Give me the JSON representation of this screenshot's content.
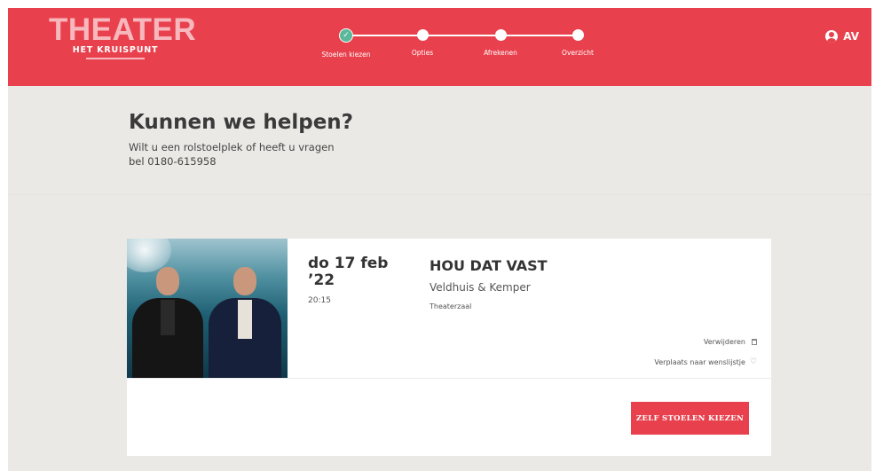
{
  "header": {
    "logo": {
      "main": "THEATER",
      "sub": "HET KRUISPUNT"
    },
    "steps": [
      {
        "label": "Stoelen kiezen",
        "status": "done"
      },
      {
        "label": "Opties",
        "status": "todo"
      },
      {
        "label": "Afrekenen",
        "status": "todo"
      },
      {
        "label": "Overzicht",
        "status": "todo"
      }
    ],
    "user": {
      "initials": "AV",
      "icon": "user-circle-icon"
    }
  },
  "help": {
    "title": "Kunnen we helpen?",
    "line1": "Wilt u een rolstoelplek of heeft u vragen",
    "line2": "bel 0180-615958"
  },
  "event": {
    "date": "do 17 feb",
    "year": "’22",
    "time": "20:15",
    "title": "HOU DAT VAST",
    "artist": "Veldhuis & Kemper",
    "venue": "Theaterzaal",
    "remove_label": "Verwijderen",
    "wishlist_label": "Verplaats naar wenslijstje"
  },
  "cta": {
    "label": "ZELF STOELEN KIEZEN"
  },
  "colors": {
    "brand": "#e8414d",
    "background": "#eae9e6",
    "step_done": "#5bb89a",
    "logo_tint": "#f6b8bd"
  }
}
